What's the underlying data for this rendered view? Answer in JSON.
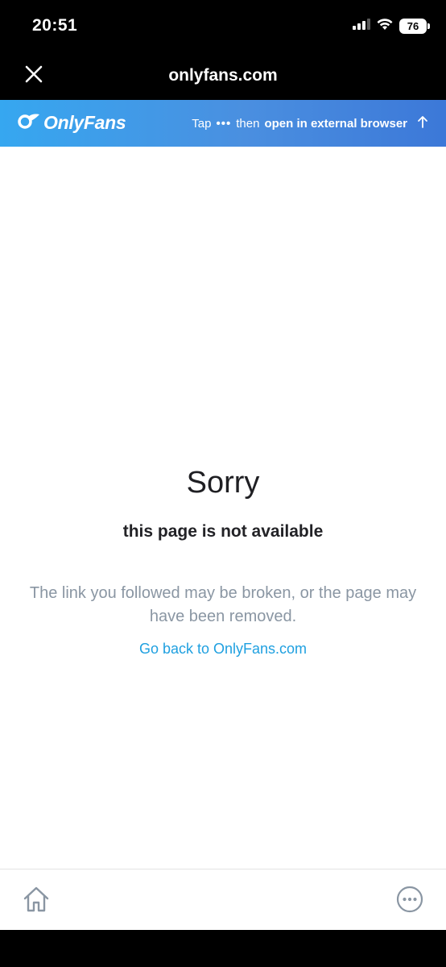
{
  "status_bar": {
    "time": "20:51",
    "battery": "76",
    "icons": [
      "cellular-signal-icon",
      "wifi-icon",
      "battery-icon"
    ]
  },
  "browser": {
    "title": "onlyfans.com",
    "close_icon": "close-icon"
  },
  "banner": {
    "logo_text": "OnlyFans",
    "hint_prefix": "Tap",
    "hint_dots": "•••",
    "hint_middle": "then",
    "hint_action": "open in external browser",
    "hint_arrow": "↑"
  },
  "error": {
    "title": "Sorry",
    "subtitle": "this page is not available",
    "description": "The link you followed may be broken, or the page may have been removed.",
    "link_text": "Go back to OnlyFans.com"
  },
  "toolbar": {
    "home_icon": "home-icon",
    "more_icon": "more-icon"
  },
  "colors": {
    "banner_start": "#36a7f0",
    "banner_end": "#3c78d8",
    "link": "#1fa0e0",
    "muted_text": "#8a96a3"
  }
}
